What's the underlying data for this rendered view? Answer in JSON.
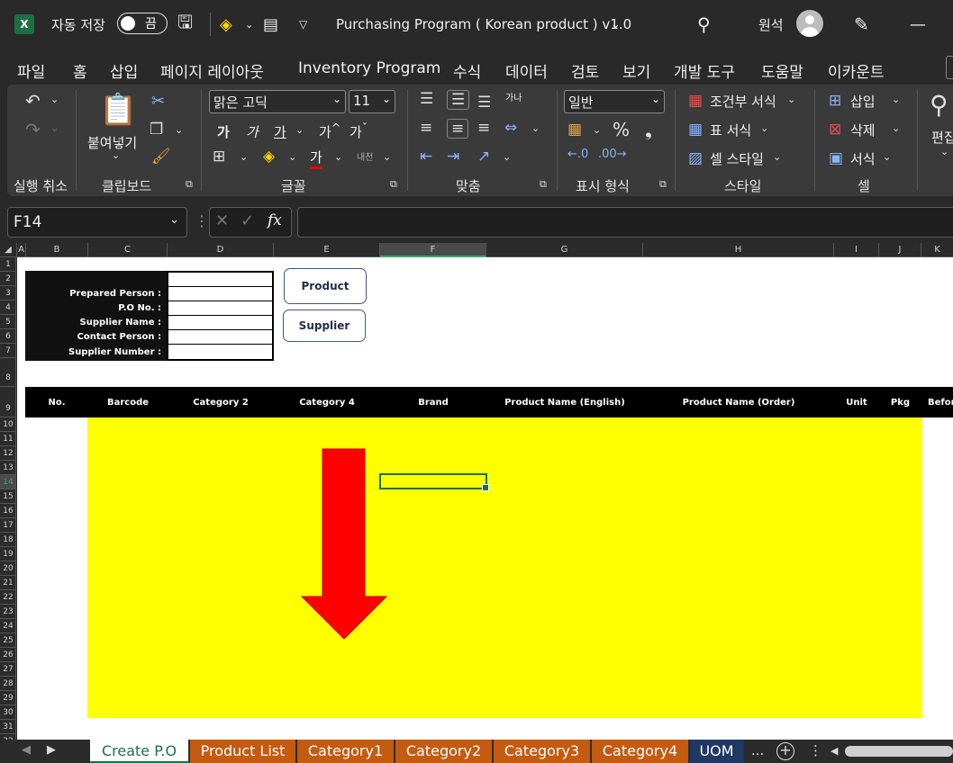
{
  "titlebar": {
    "autosave_label": "자동 저장",
    "autosave_state": "끔",
    "title": "Purchasing Program ( Korean product ) v1.0",
    "user": "원석"
  },
  "menu": [
    "파일",
    "홈",
    "삽입",
    "페이지 레이아웃",
    "Inventory Program",
    "수식",
    "데이터",
    "검토",
    "보기",
    "개발 도구",
    "도움말",
    "이카운트"
  ],
  "ribbon": {
    "undo_label": "실행 취소",
    "paste_label": "붙여넣기",
    "clipboard_label": "클립보드",
    "font_name": "맑은 고딕",
    "font_size": "11",
    "font_label": "글꼴",
    "align_label": "맞춤",
    "number_format": "일반",
    "number_label": "표시 형식",
    "cond_format": "조건부 서식",
    "table_format": "표 서식",
    "cell_style": "셀 스타일",
    "style_label": "스타일",
    "insert": "삽입",
    "delete": "삭제",
    "format": "서식",
    "cells_label": "셀",
    "edit_label": "편집",
    "bold": "가",
    "italic": "가",
    "underline": "가",
    "font_color": "가",
    "wrap": "내천",
    "grow": "가",
    "shrink": "가",
    "text_dir": "가나"
  },
  "formula": {
    "cell_ref": "F14",
    "fx": "fx",
    "value": ""
  },
  "columns": [
    "A",
    "B",
    "C",
    "D",
    "E",
    "F",
    "G",
    "H",
    "I",
    "J",
    "K"
  ],
  "rows": [
    "1",
    "2",
    "3",
    "4",
    "5",
    "6",
    "7",
    "8",
    "9",
    "10",
    "11",
    "12",
    "13",
    "14",
    "15",
    "16",
    "17",
    "18",
    "19",
    "20",
    "21",
    "22",
    "23",
    "24",
    "25",
    "26",
    "27",
    "28",
    "29",
    "30",
    "31",
    "32"
  ],
  "info_labels": [
    "Prepared Person :",
    "P.O No. :",
    "Supplier Name :",
    "Contact Person :",
    "Supplier Number :"
  ],
  "buttons": {
    "product": "Product",
    "supplier": "Supplier"
  },
  "table_headers": [
    "No.",
    "Barcode",
    "Category 2",
    "Category 4",
    "Brand",
    "Product Name (English)",
    "Product Name (Order)",
    "Unit",
    "Pkg",
    "Befor"
  ],
  "tabs": [
    "Create P.O",
    "Product List",
    "Category1",
    "Category2",
    "Category3",
    "Category4",
    "UOM"
  ],
  "tab_more": "...",
  "colors": {
    "yellow": "#ffff00",
    "arrow": "#ff0000",
    "excel_green": "#1e7145",
    "tab_orange": "#c55a11",
    "tab_navy": "#1f3864"
  }
}
